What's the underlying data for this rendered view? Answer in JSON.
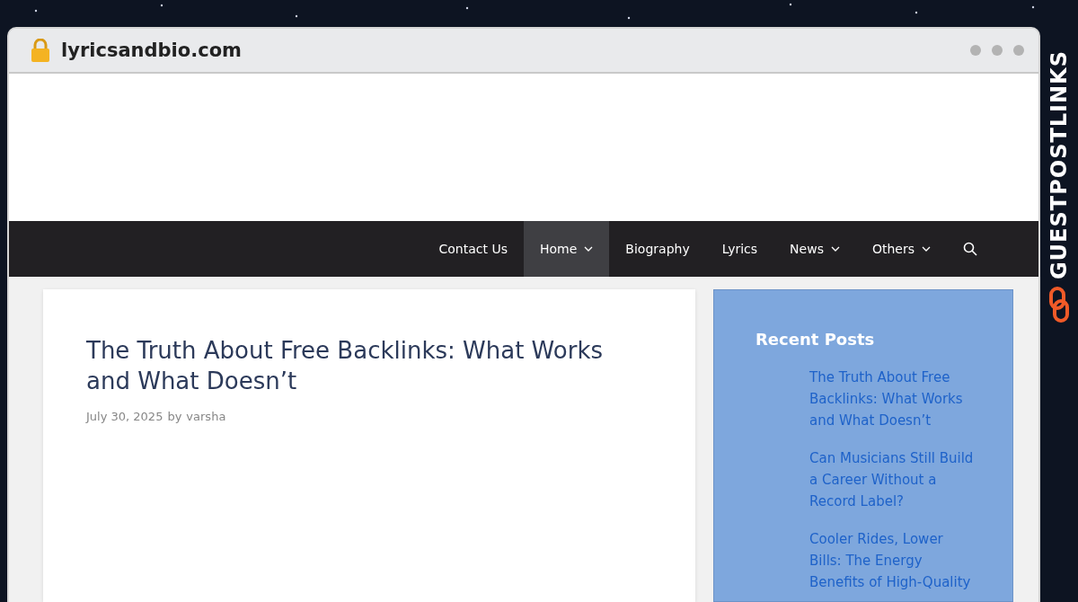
{
  "browser": {
    "url": "lyricsandbio.com"
  },
  "brand": {
    "name": "GUESTPOSTLINKS"
  },
  "nav": {
    "items": [
      {
        "label": "Contact Us",
        "selected": false,
        "has_menu": false
      },
      {
        "label": "Home",
        "selected": true,
        "has_menu": true
      },
      {
        "label": "Biography",
        "selected": false,
        "has_menu": false
      },
      {
        "label": "Lyrics",
        "selected": false,
        "has_menu": false
      },
      {
        "label": "News",
        "selected": false,
        "has_menu": true
      },
      {
        "label": "Others",
        "selected": false,
        "has_menu": true
      }
    ]
  },
  "article": {
    "title": "The Truth About Free Backlinks: What Works and What Doesn’t",
    "date": "July 30, 2025",
    "by": "by",
    "author": "varsha"
  },
  "sidebar": {
    "title": "Recent Posts",
    "posts": [
      "The Truth About Free Backlinks: What Works and What Doesn’t",
      "Can Musicians Still Build a Career Without a Record Label?",
      "Cooler Rides, Lower Bills: The Energy Benefits of High-Quality"
    ]
  }
}
